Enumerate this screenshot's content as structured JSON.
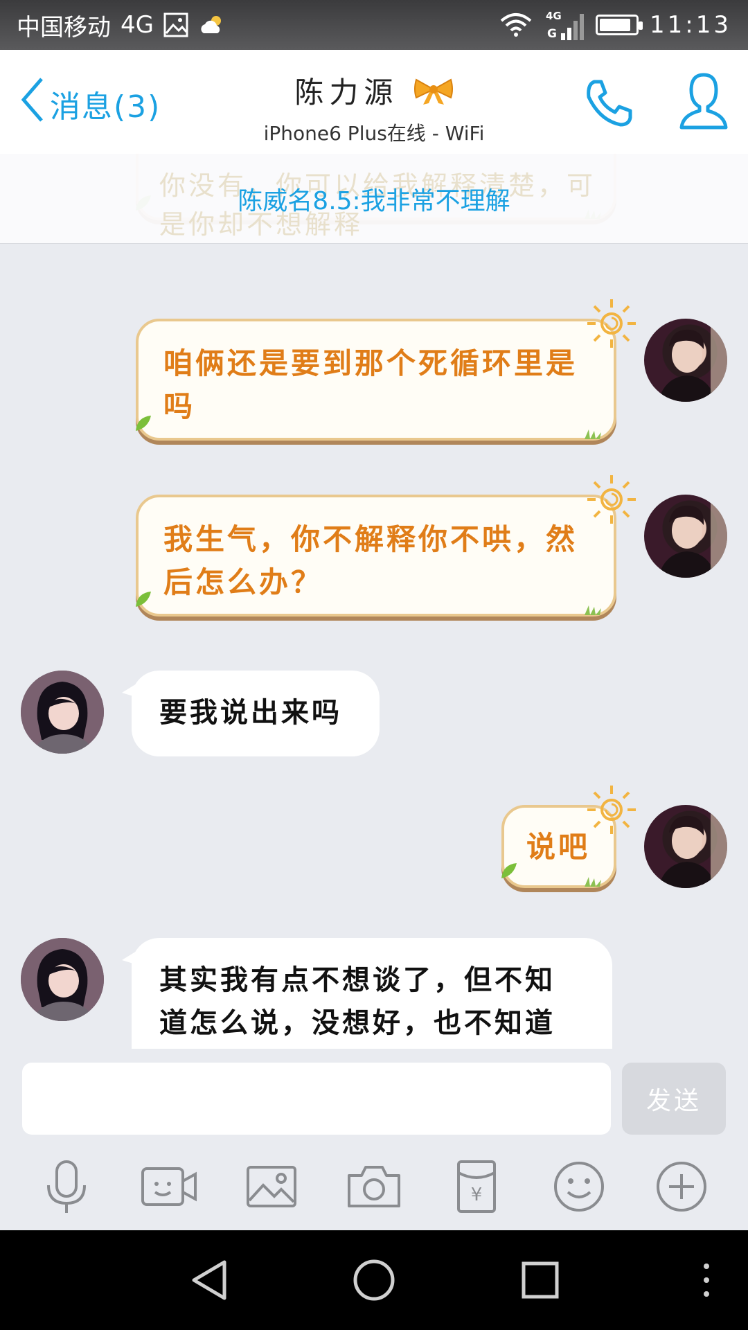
{
  "status_bar": {
    "carrier": "中国移动",
    "network": "4G",
    "signal_label": "4G",
    "time": "11:13"
  },
  "header": {
    "back_label": "消息(3)",
    "contact_name": "陈力源",
    "device_status": "iPhone6 Plus在线 - WiFi",
    "icons": [
      "chevron-left-icon",
      "bow-icon",
      "phone-icon",
      "profile-icon"
    ]
  },
  "banner": {
    "text": "陈威名8.5:我非常不理解",
    "ghost_text": "你没有，你可以给我解释清楚，可是你却不想解释"
  },
  "messages": [
    {
      "side": "right",
      "style": "fancy",
      "text": "咱俩还是要到那个死循环里是吗"
    },
    {
      "side": "right",
      "style": "fancy",
      "text": "我生气，你不解释你不哄，然后怎么办？"
    },
    {
      "side": "left",
      "style": "plain",
      "text": "要我说出来吗"
    },
    {
      "side": "right",
      "style": "fancy",
      "text": "说吧"
    },
    {
      "side": "left",
      "style": "plain",
      "text": "其实我有点不想谈了，但不知道怎么说，没想好，也不知道"
    }
  ],
  "input": {
    "value": "",
    "placeholder": "",
    "send_label": "发送"
  },
  "toolbar": {
    "items": [
      "microphone-icon",
      "video-call-icon",
      "image-icon",
      "camera-icon",
      "red-packet-icon",
      "emoji-icon",
      "add-icon"
    ]
  },
  "nav": {
    "items": [
      "back-triangle-icon",
      "home-circle-icon",
      "recents-square-icon",
      "more-dots-icon"
    ]
  },
  "colors": {
    "accent": "#1ba1e2",
    "fancy_text": "#e07d18",
    "fancy_border": "#e9c88e",
    "background": "#e9ebf0"
  }
}
